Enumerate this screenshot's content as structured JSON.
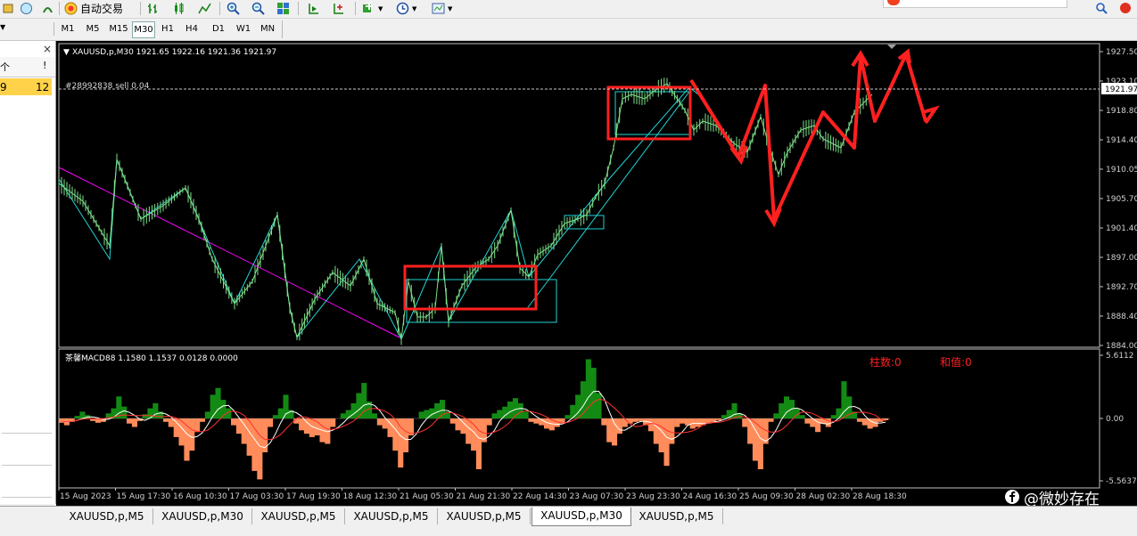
{
  "toolbar": {
    "auto_trading_label": "自动交易"
  },
  "timeframes": [
    "M1",
    "M5",
    "M15",
    "M30",
    "H1",
    "H4",
    "D1",
    "W1",
    "MN"
  ],
  "active_timeframe": "M30",
  "left_panel": {
    "header_col1": "个",
    "header_col2": "!",
    "close_glyph": "×",
    "row_value_left": "9",
    "row_value_right": "12"
  },
  "chart": {
    "info": "XAUUSD,p,M30  1921.65 1922.16 1921.36 1921.97",
    "order_label": "#28992838 sell 0.04",
    "current_price": "1921.97",
    "price_ticks": [
      "1927.50",
      "1923.10",
      "1918.80",
      "1914.40",
      "1910.05",
      "1905.70",
      "1901.40",
      "1897.00",
      "1892.70",
      "1888.40",
      "1884.00"
    ],
    "macd_label": "茶馨MACD88 1.1580 1.1537 0.0128 0.0000",
    "macd_ticks": [
      "5.6112",
      "0.00",
      "-5.5637"
    ],
    "bar_count_label": "柱数:0",
    "sum_label": "和值:0",
    "time_labels": [
      "15 Aug 2023",
      "15 Aug 17:30",
      "16 Aug 10:30",
      "17 Aug 03:30",
      "17 Aug 19:30",
      "18 Aug 12:30",
      "21 Aug 05:30",
      "21 Aug 21:30",
      "22 Aug 14:30",
      "23 Aug 07:30",
      "23 Aug 23:30",
      "24 Aug 16:30",
      "25 Aug 09:30",
      "28 Aug 02:30",
      "28 Aug 18:30"
    ],
    "watermark": "@微妙存在",
    "colors": {
      "candles": "#7ee08a",
      "trend": "#ff00ff",
      "boxes": "#22d3d3",
      "annot": "#ff2020",
      "macd_up": "#138a13",
      "macd_dn": "#ff8c5a"
    }
  },
  "tabs": [
    "XAUUSD,p,M5",
    "XAUUSD,p,M30",
    "XAUUSD,p,M5",
    "XAUUSD,p,M5",
    "XAUUSD,p,M5",
    "XAUUSD,p,M30",
    "XAUUSD,p,M5"
  ],
  "active_tab_index": 5
}
